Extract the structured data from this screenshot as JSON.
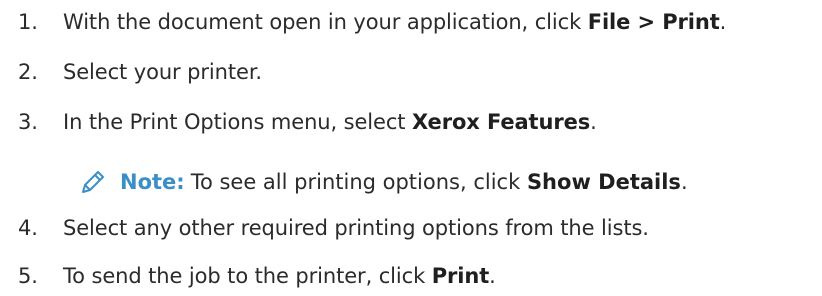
{
  "steps": [
    {
      "number": "1.",
      "before": "With the document open in your application, click ",
      "bold": "File > Print",
      "after": "."
    },
    {
      "number": "2.",
      "text": "Select your printer."
    },
    {
      "number": "3.",
      "before": "In the Print Options menu, select ",
      "bold": "Xerox Features",
      "after": "."
    },
    {
      "number": "4.",
      "text": "Select any other required printing options from the lists."
    },
    {
      "number": "5.",
      "before": "To send the job to the printer, click ",
      "bold": "Print",
      "after": "."
    }
  ],
  "note": {
    "icon": "pencil-icon",
    "label": "Note:",
    "before": " To see all printing options, click ",
    "bold": "Show Details",
    "after": ".",
    "color": "#3a8fc7"
  }
}
